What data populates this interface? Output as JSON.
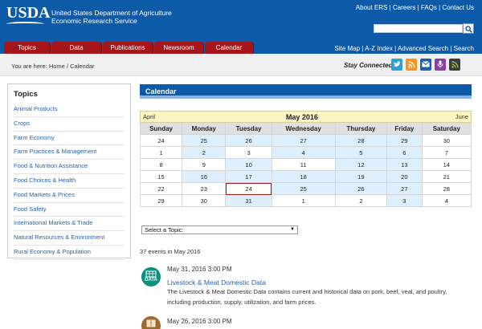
{
  "header": {
    "logo": "USDA",
    "agency_line1": "United States Department of Agriculture",
    "agency_line2": "Economic Research Service",
    "top_links": [
      "About ERS",
      "Careers",
      "FAQs",
      "Contact Us"
    ],
    "search_placeholder": ""
  },
  "nav": {
    "tabs": [
      "Topics",
      "Data",
      "Publications",
      "Newsroom",
      "Calendar"
    ],
    "right_links": [
      "Site Map",
      "A-Z Index",
      "Advanced Search",
      "Search"
    ]
  },
  "breadcrumb": "You are here: Home / Calendar",
  "social": {
    "label": "Stay Connected",
    "icons": [
      "twitter-icon",
      "rss-icon",
      "email-icon",
      "podcast-icon",
      "feed-icon"
    ]
  },
  "sidebar": {
    "title": "Topics",
    "items": [
      "Animal Products",
      "Crops",
      "Farm Economy",
      "Farm Practices & Management",
      "Food & Nutrition Assistance",
      "Food Choices & Health",
      "Food Markets & Prices",
      "Food Safety",
      "International Markets & Trade",
      "Natural Resources & Environment",
      "Rural Economy & Population"
    ]
  },
  "calendar": {
    "heading": "Calendar",
    "prev": "April",
    "month": "May 2016",
    "next": "June",
    "weekdays": [
      "Sunday",
      "Monday",
      "Tuesday",
      "Wednesday",
      "Thursday",
      "Friday",
      "Saturday"
    ],
    "weeks": [
      [
        "24",
        "25",
        "26",
        "27",
        "28",
        "29",
        "30"
      ],
      [
        "1",
        "2",
        "3",
        "4",
        "5",
        "6",
        "7"
      ],
      [
        "8",
        "9",
        "10",
        "11",
        "12",
        "13",
        "14"
      ],
      [
        "15",
        "16",
        "17",
        "18",
        "19",
        "20",
        "21"
      ],
      [
        "22",
        "23",
        "24",
        "25",
        "26",
        "27",
        "28"
      ],
      [
        "29",
        "30",
        "31",
        "1",
        "2",
        "3",
        "4"
      ]
    ]
  },
  "topic_select": {
    "value": "Select a Topic:"
  },
  "events_count": "37 events in May 2016",
  "events": [
    {
      "icon_label": "DATA",
      "date": "May 31, 2016 3:00 PM",
      "title": "Livestock & Meat Domestic Data",
      "desc": "The Livestock & Meat Domestic Data contains current and historical data on pork, beef, veal, and poultry, including production, supply, utilization, and farm prices."
    },
    {
      "icon_label": "",
      "date": "May 26, 2016 3:00 PM",
      "title": "",
      "desc": ""
    }
  ],
  "colors": {
    "brand_blue": "#0d5ba8",
    "tab_red": "#a4161a",
    "event_day": "#ddeefc",
    "month_bar": "#fbf4c3",
    "data_icon": "#0b8f7e"
  }
}
